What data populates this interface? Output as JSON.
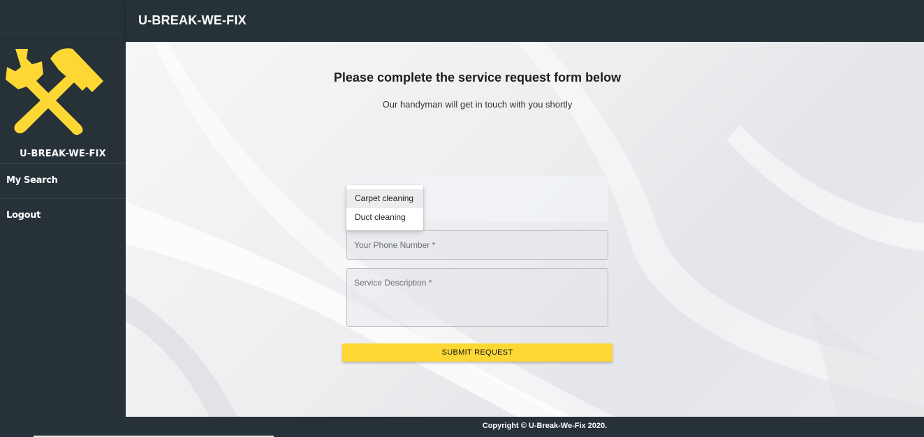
{
  "app": {
    "title": "U-BREAK-WE-FIX",
    "brand": "U-BREAK-WE-FIX"
  },
  "sidebar": {
    "items": [
      {
        "label": "My Search",
        "icon": "none"
      },
      {
        "label": "Logout",
        "icon": "none"
      }
    ]
  },
  "logo": {
    "icon": "tools-icon",
    "color": "#FDD835"
  },
  "main": {
    "heading": "Please complete the service request form below",
    "subheading": "Our handyman will get in touch with you shortly"
  },
  "form": {
    "service_options": [
      "Carpet cleaning",
      "Duct cleaning"
    ],
    "phone_placeholder": "Your Phone Number *",
    "description_placeholder": "Service Description *",
    "submit_label": "SUBMIT REQUEST"
  },
  "footer": {
    "copyright": "Copyright © U-Break-We-Fix 2020."
  },
  "colors": {
    "sidebar": "#263238",
    "accent": "#FDD835",
    "text": "#FFFFFF"
  }
}
